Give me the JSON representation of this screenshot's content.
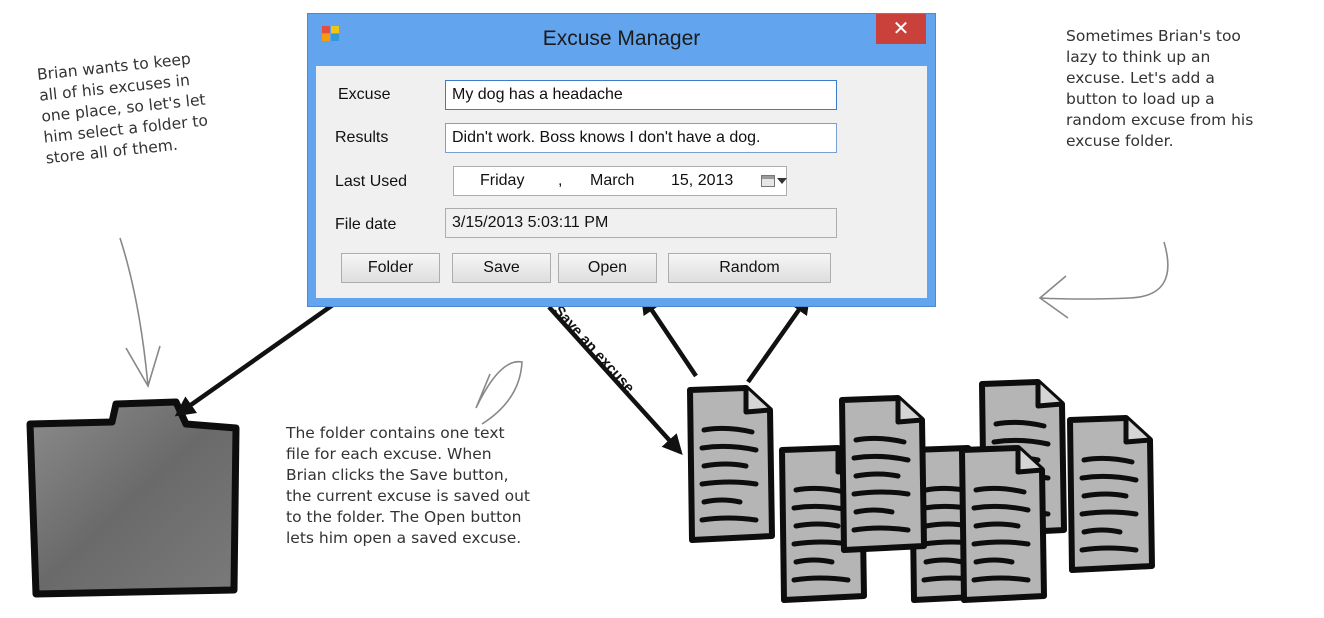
{
  "window": {
    "title": "Excuse Manager",
    "close_glyph": "✕",
    "icon": "app-window-icon"
  },
  "form": {
    "excuse_label": "Excuse",
    "excuse_value": "My dog has a headache",
    "results_label": "Results",
    "results_value": "Didn't work. Boss knows I don't have a dog.",
    "last_used_label": "Last Used",
    "last_used": {
      "weekday": "Friday",
      "comma": ",",
      "month": "March",
      "day_year": "15, 2013"
    },
    "file_date_label": "File date",
    "file_date_value": "3/15/2013 5:03:11 PM"
  },
  "buttons": {
    "folder": "Folder",
    "save": "Save",
    "open": "Open",
    "random": "Random"
  },
  "annotations": {
    "left": [
      "Brian wants to keep",
      "all of his excuses in",
      "one place, so let's let",
      "him select a folder to",
      "store all of them."
    ],
    "right": [
      "Sometimes Brian's too",
      "lazy to think up an",
      "excuse. Let's add a",
      "button to load up a",
      "random excuse from his",
      "excuse folder."
    ],
    "bottom": [
      "The folder contains one text",
      "file for each excuse. When",
      "Brian clicks the Save button,",
      "the current excuse is saved out",
      "to the folder. The Open button",
      "lets him open a saved excuse."
    ],
    "save_arrow_label": "Save an excuse"
  },
  "colors": {
    "title_bar": "#62a4ee",
    "close_button": "#c9413a",
    "folder_fill": "#777777",
    "document_fill": "#b5b5b5"
  }
}
